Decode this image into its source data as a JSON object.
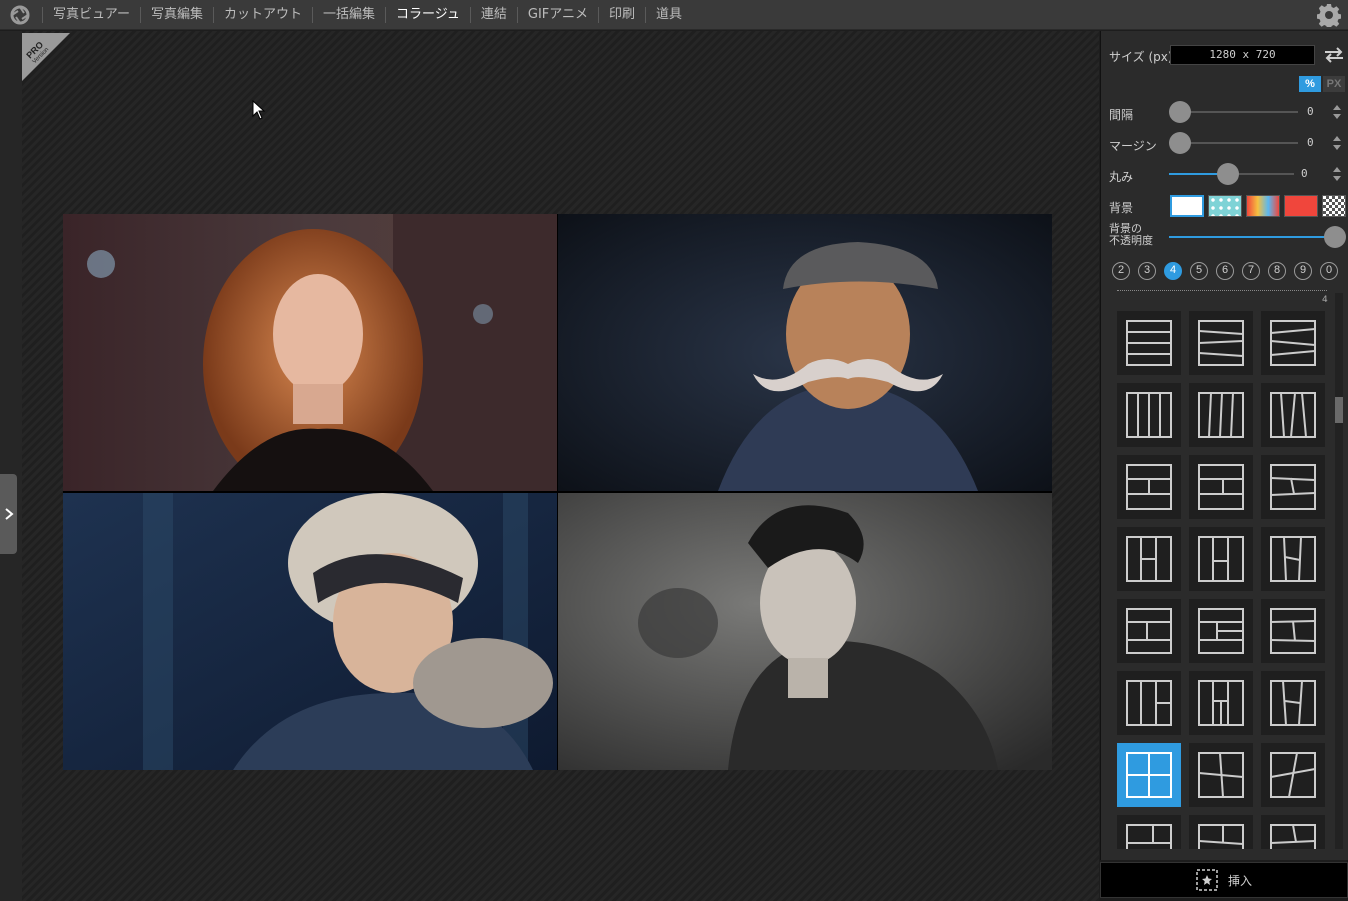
{
  "menu": {
    "items": [
      {
        "label": "写真ビュアー",
        "active": false
      },
      {
        "label": "写真編集",
        "active": false
      },
      {
        "label": "カットアウト",
        "active": false
      },
      {
        "label": "一括編集",
        "active": false
      },
      {
        "label": "コラージュ",
        "active": true
      },
      {
        "label": "連結",
        "active": false
      },
      {
        "label": "GIFアニメ",
        "active": false
      },
      {
        "label": "印刷",
        "active": false
      },
      {
        "label": "道具",
        "active": false
      }
    ]
  },
  "badge": {
    "line1": "PRO",
    "line2": "Version"
  },
  "panel": {
    "size_label": "サイズ (px)",
    "size_value": "1280 x 720",
    "unit_percent": "%",
    "unit_px": "PX",
    "spacing": {
      "label": "間隔",
      "value": "0",
      "level": 0
    },
    "margin": {
      "label": "マージン",
      "value": "0",
      "level": 0
    },
    "rounding": {
      "label": "丸み",
      "value": "0",
      "level": 0.47
    },
    "background_label": "背景",
    "opacity_label_line1": "背景の",
    "opacity_label_line2": "不透明度",
    "opacity_level": 1.0,
    "photo_counts": [
      "2",
      "3",
      "4",
      "5",
      "6",
      "7",
      "8",
      "9",
      "0"
    ],
    "selected_count": "4",
    "layout_count": "4",
    "insert_label": "挿入"
  },
  "colors": {
    "accent": "#2f9be0",
    "swatches": [
      "#ffffff",
      "#7fd3d6",
      "rainbow",
      "#f0463c",
      "checker"
    ]
  }
}
